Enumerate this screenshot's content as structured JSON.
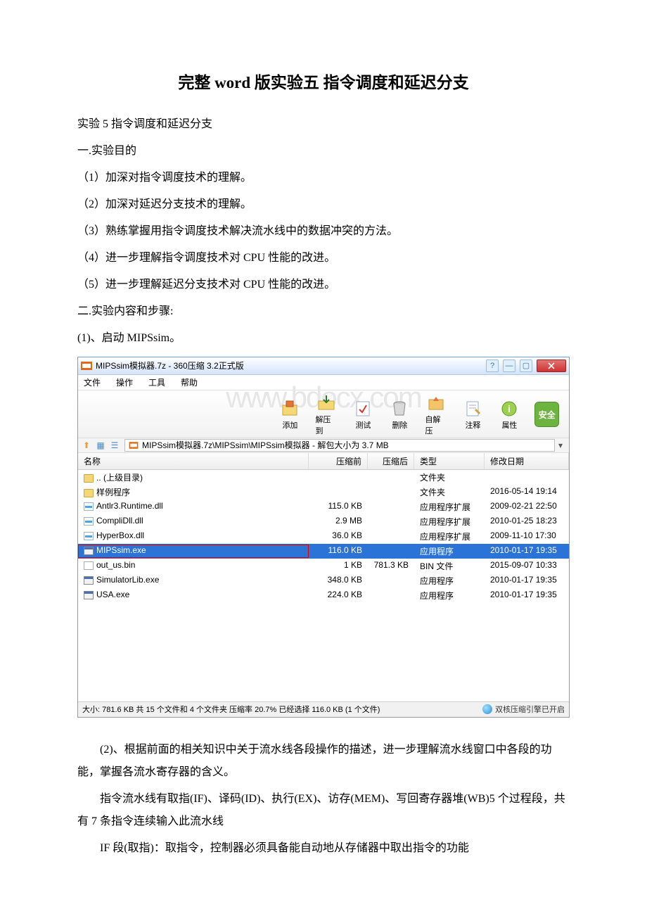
{
  "doc": {
    "title": "完整 word 版实验五 指令调度和延迟分支",
    "sub": "实验 5 指令调度和延迟分支",
    "purpose_h": "一.实验目的",
    "p1": "（1）加深对指令调度技术的理解。",
    "p2": "（2）加深对延迟分支技术的理解。",
    "p3": "（3）熟练掌握用指令调度技术解决流水线中的数据冲突的方法。",
    "p4": "（4）进一步理解指令调度技术对 CPU 性能的改进。",
    "p5": "（5）进一步理解延迟分支技术对 CPU 性能的改进。",
    "steps_h": "二.实验内容和步骤:",
    "s1": "(1)、启动 MIPSsim。",
    "s2": "(2)、根据前面的相关知识中关于流水线各段操作的描述，进一步理解流水线窗口中各段的功能，掌握各流水寄存器的含义。",
    "s3": "指令流水线有取指(IF)、译码(ID)、执行(EX)、访存(MEM)、写回寄存器堆(WB)5 个过程段，共有 7 条指令连续输入此流水线",
    "s4": "IF 段(取指)：取指令，控制器必须具备能自动地从存储器中取出指令的功能"
  },
  "win": {
    "title": "MIPSsim模拟器.7z - 360压缩 3.2正式版",
    "menu": [
      "文件",
      "操作",
      "工具",
      "帮助"
    ],
    "tools": [
      "添加",
      "解压到",
      "测试",
      "删除",
      "自解压",
      "注释",
      "属性"
    ],
    "safe": "安全",
    "path": "MIPSsim模拟器.7z\\MIPSsim\\MIPSsim模拟器 - 解包大小为 3.7 MB",
    "cols": [
      "名称",
      "压缩前",
      "压缩后",
      "类型",
      "修改日期"
    ],
    "rows": [
      {
        "ic": "folder",
        "name": ".. (上级目录)",
        "pre": "",
        "post": "",
        "type": "文件夹",
        "date": ""
      },
      {
        "ic": "folder",
        "name": "样例程序",
        "pre": "",
        "post": "",
        "type": "文件夹",
        "date": "2016-05-14 19:14"
      },
      {
        "ic": "dll",
        "name": "Antlr3.Runtime.dll",
        "pre": "115.0 KB",
        "post": "",
        "type": "应用程序扩展",
        "date": "2009-02-21 22:50"
      },
      {
        "ic": "dll",
        "name": "CompliDll.dll",
        "pre": "2.9 MB",
        "post": "",
        "type": "应用程序扩展",
        "date": "2010-01-25 18:23"
      },
      {
        "ic": "dll",
        "name": "HyperBox.dll",
        "pre": "36.0 KB",
        "post": "",
        "type": "应用程序扩展",
        "date": "2009-11-10 17:30"
      },
      {
        "ic": "exe",
        "name": "MIPSsim.exe",
        "pre": "116.0 KB",
        "post": "",
        "type": "应用程序",
        "date": "2010-01-17 19:35",
        "sel": true
      },
      {
        "ic": "bin",
        "name": "out_us.bin",
        "pre": "1 KB",
        "post": "781.3 KB",
        "type": "BIN 文件",
        "date": "2015-09-07 10:33"
      },
      {
        "ic": "exe",
        "name": "SimulatorLib.exe",
        "pre": "348.0 KB",
        "post": "",
        "type": "应用程序",
        "date": "2010-01-17 19:35"
      },
      {
        "ic": "exe",
        "name": "USA.exe",
        "pre": "224.0 KB",
        "post": "",
        "type": "应用程序",
        "date": "2010-01-17 19:35"
      }
    ],
    "status": "大小: 781.6 KB 共 15 个文件和 4 个文件夹 压缩率 20.7% 已经选择 116.0 KB (1 个文件)",
    "engine": "双核压缩引擎已开启"
  },
  "watermark": "www.bdocx.com"
}
